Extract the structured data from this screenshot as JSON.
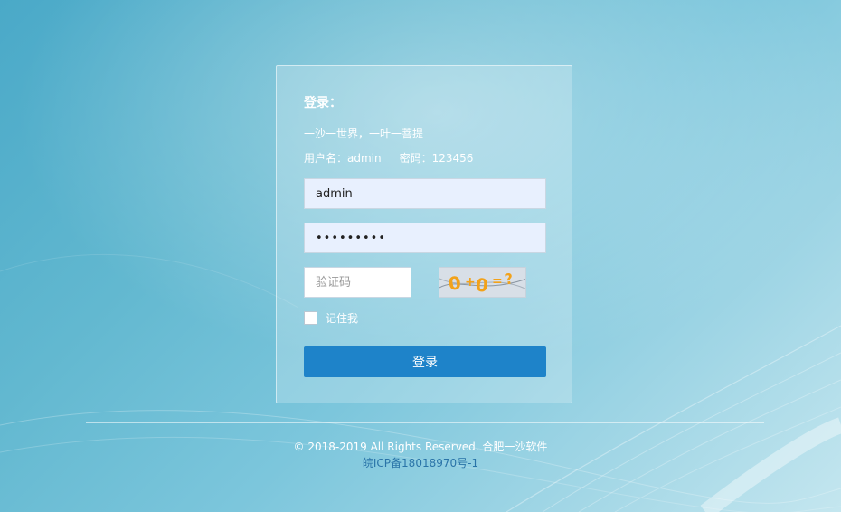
{
  "login": {
    "title": "登录：",
    "motto": "一沙一世界，一叶一菩提",
    "hint_username": "用户名：admin",
    "hint_password": "密码：123456",
    "username_value": "admin",
    "password_value": "•••••••••",
    "captcha_placeholder": "验证码",
    "captcha_image_text": "0+0=?",
    "remember_label": "记住我",
    "remember_checked": false,
    "submit_label": "登录"
  },
  "footer": {
    "copyright": "© 2018-2019 All Rights Reserved. 合肥一沙软件",
    "icp": "皖ICP备18018970号-1"
  },
  "colors": {
    "button": "#1e83c9",
    "input_bg": "#e8f0fe",
    "icp_link": "#2a74a8",
    "captcha_chars": "#f2a21a"
  }
}
